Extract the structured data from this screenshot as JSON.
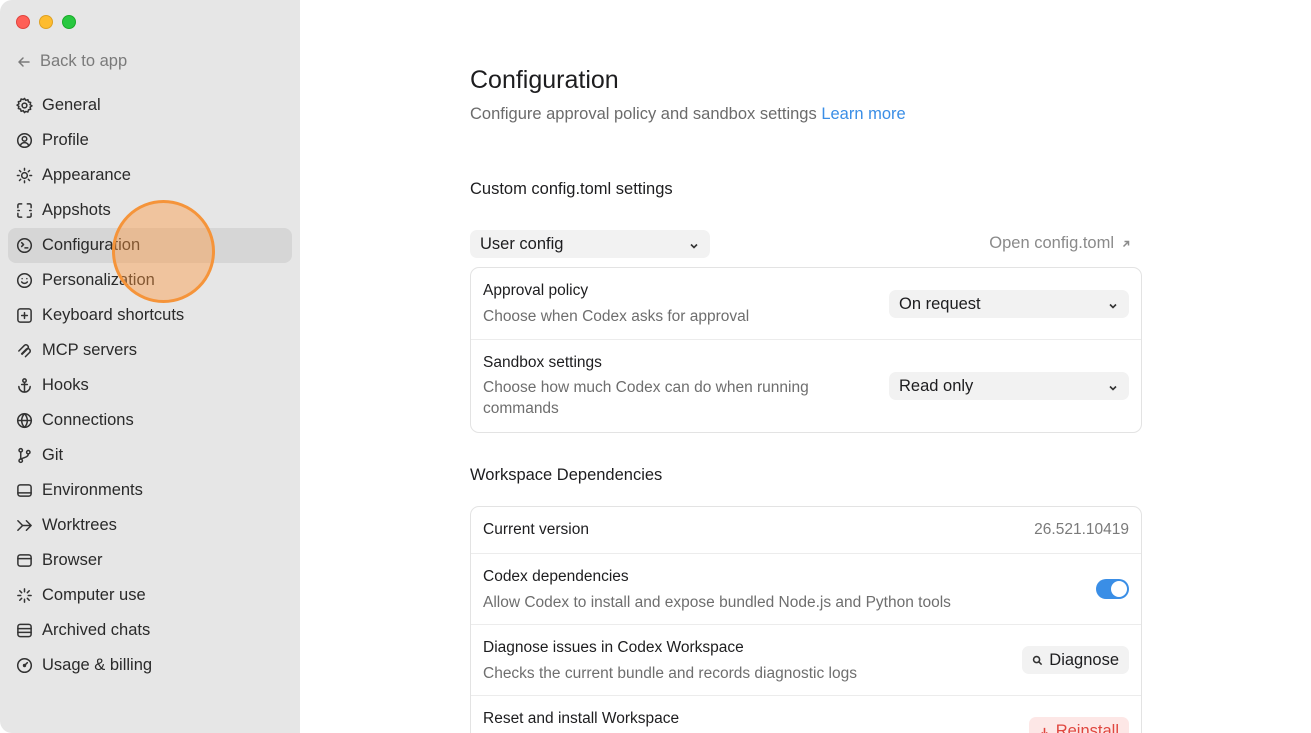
{
  "sidebar": {
    "back_label": "Back to app",
    "items": [
      {
        "label": "General",
        "icon": "gear-icon"
      },
      {
        "label": "Profile",
        "icon": "profile-icon"
      },
      {
        "label": "Appearance",
        "icon": "sun-icon"
      },
      {
        "label": "Appshots",
        "icon": "capture-icon"
      },
      {
        "label": "Configuration",
        "icon": "config-icon",
        "active": true
      },
      {
        "label": "Personalization",
        "icon": "personalization-icon"
      },
      {
        "label": "Keyboard shortcuts",
        "icon": "keyboard-icon"
      },
      {
        "label": "MCP servers",
        "icon": "mcp-icon"
      },
      {
        "label": "Hooks",
        "icon": "anchor-icon"
      },
      {
        "label": "Connections",
        "icon": "globe-icon"
      },
      {
        "label": "Git",
        "icon": "git-branch-icon"
      },
      {
        "label": "Environments",
        "icon": "laptop-icon"
      },
      {
        "label": "Worktrees",
        "icon": "worktree-icon"
      },
      {
        "label": "Browser",
        "icon": "browser-icon"
      },
      {
        "label": "Computer use",
        "icon": "sparkle-icon"
      },
      {
        "label": "Archived chats",
        "icon": "archive-icon"
      },
      {
        "label": "Usage & billing",
        "icon": "gauge-icon"
      }
    ]
  },
  "main": {
    "title": "Configuration",
    "subtitle": "Configure approval policy and sandbox settings",
    "learn_more": "Learn more",
    "custom_section_title": "Custom config.toml settings",
    "config_select": "User config",
    "open_config": "Open config.toml",
    "approval": {
      "title": "Approval policy",
      "desc": "Choose when Codex asks for approval",
      "value": "On request"
    },
    "sandbox": {
      "title": "Sandbox settings",
      "desc": "Choose how much Codex can do when running commands",
      "value": "Read only"
    },
    "workspace_section_title": "Workspace Dependencies",
    "current_version": {
      "title": "Current version",
      "value": "26.521.10419"
    },
    "codex_deps": {
      "title": "Codex dependencies",
      "desc": "Allow Codex to install and expose bundled Node.js and Python tools",
      "enabled": true
    },
    "diagnose": {
      "title": "Diagnose issues in Codex Workspace",
      "desc": "Checks the current bundle and records diagnostic logs",
      "button": "Diagnose"
    },
    "reset": {
      "title": "Reset and install Workspace",
      "button": "Reinstall"
    }
  },
  "colors": {
    "accent": "#3a8ee6",
    "danger": "#e0463f",
    "sidebar_bg": "#e6e6e6",
    "active_item_bg": "#d6d6d6"
  }
}
